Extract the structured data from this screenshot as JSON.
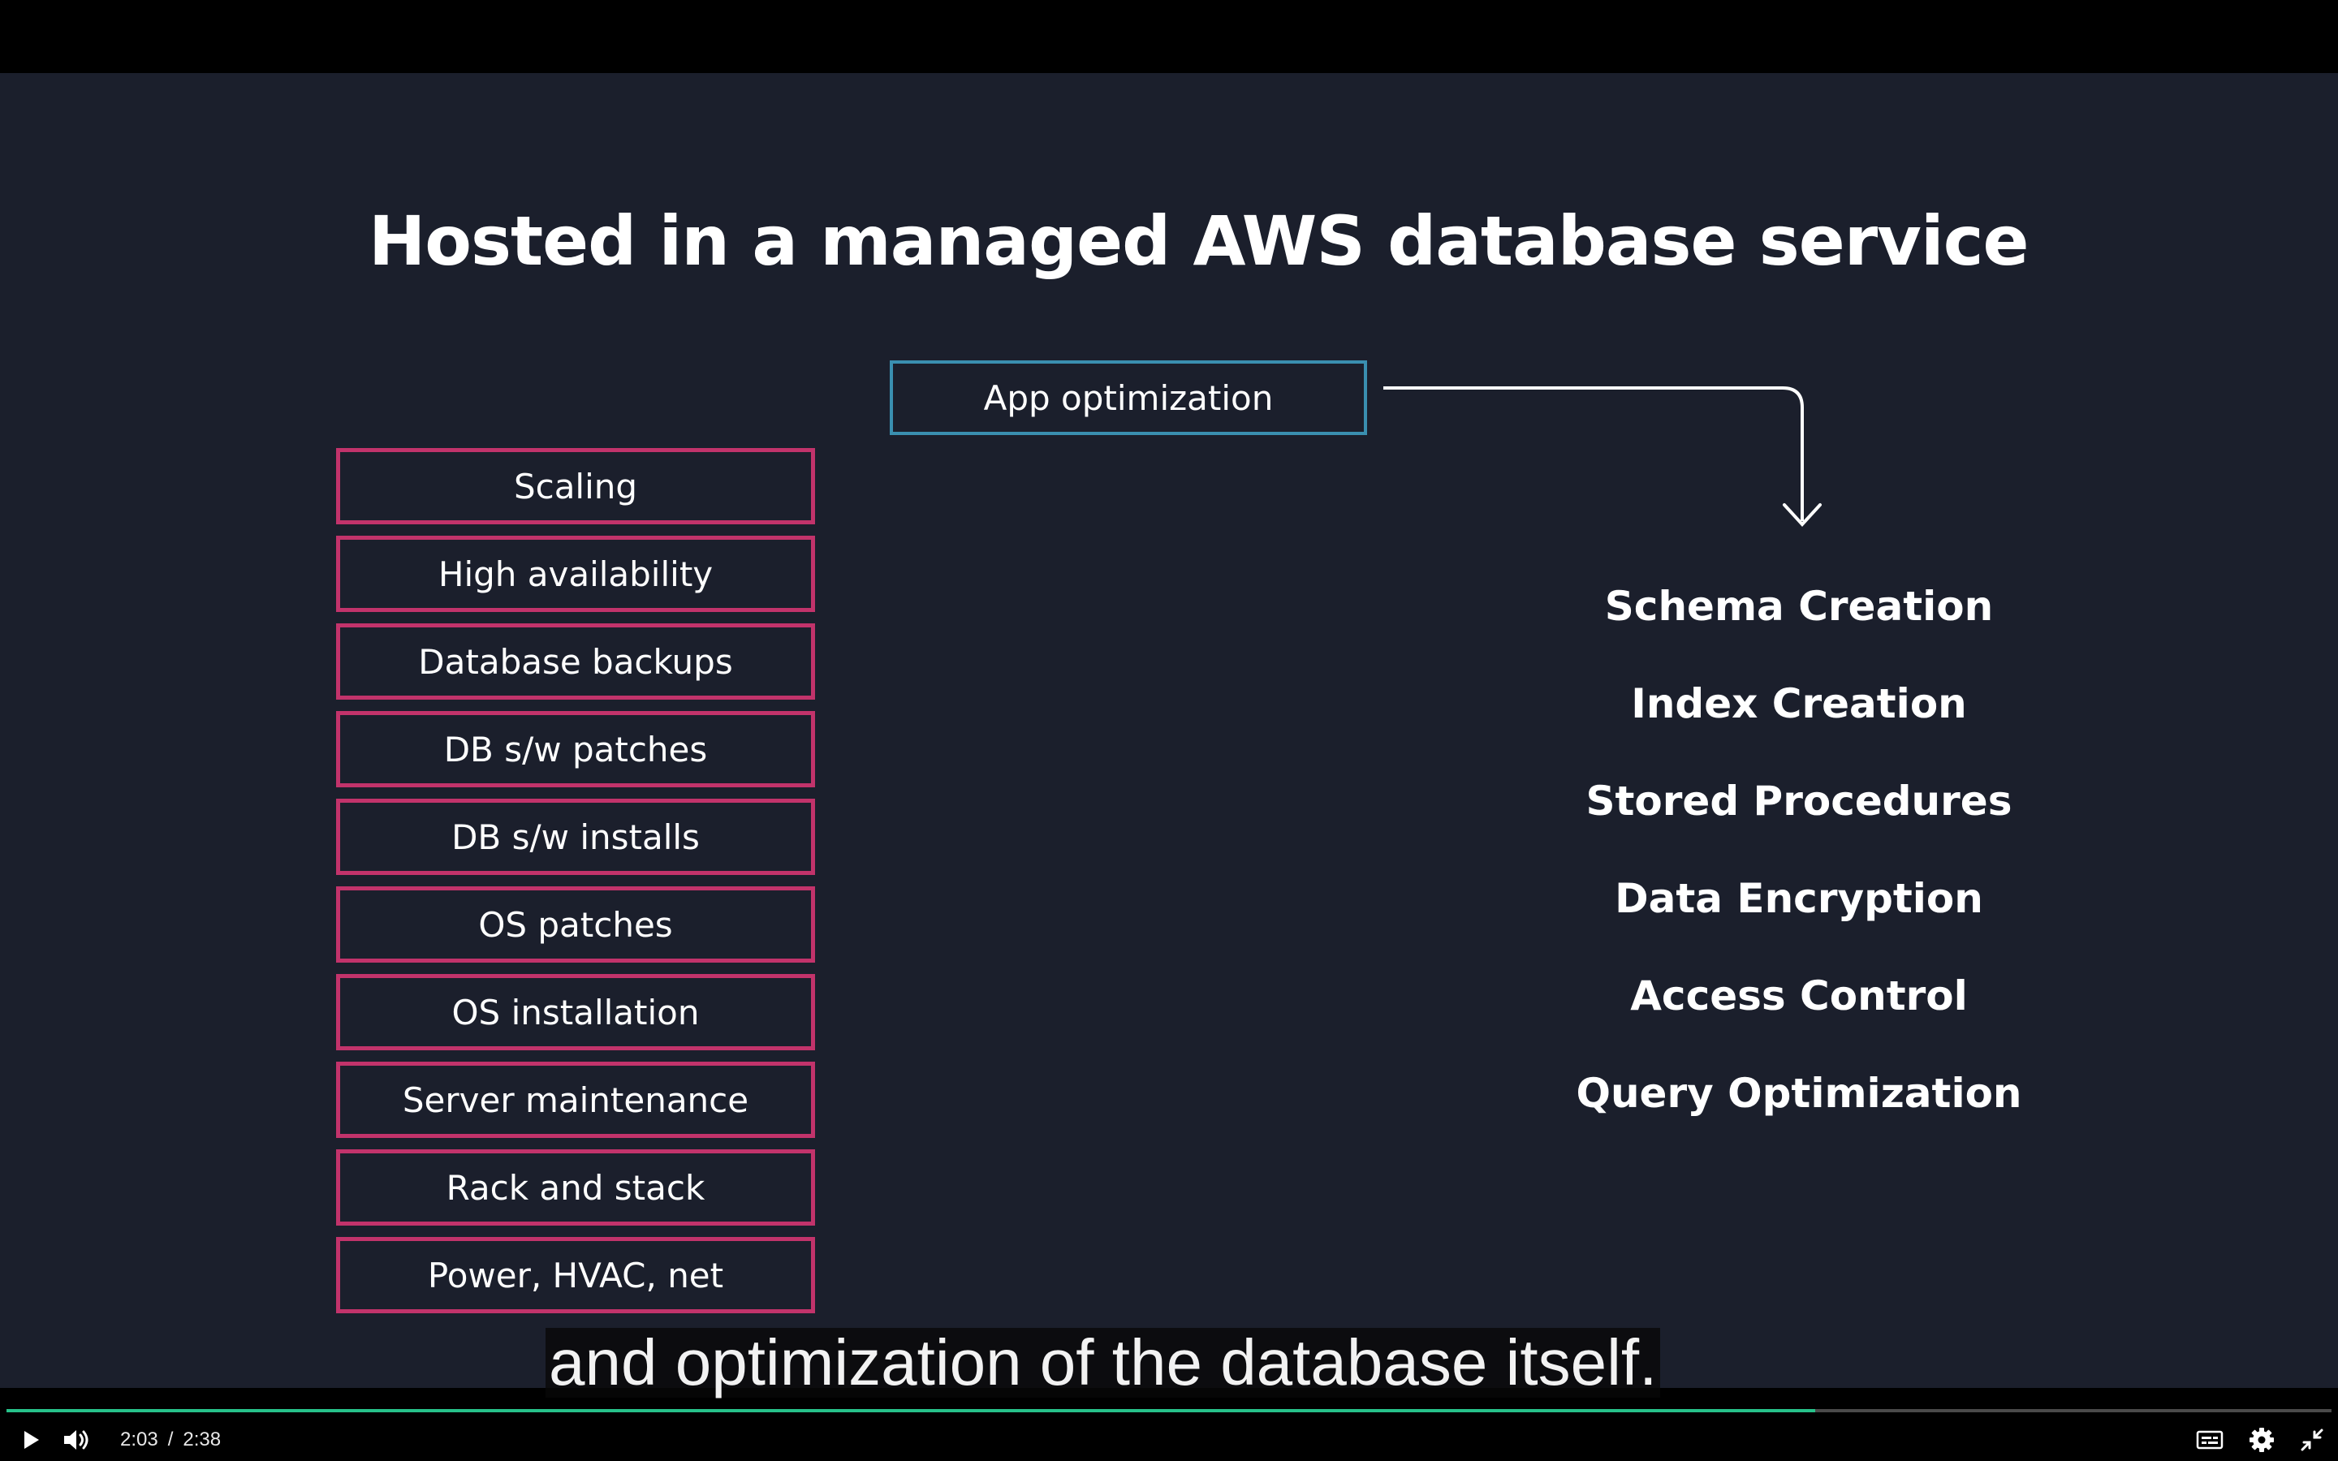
{
  "slide": {
    "title": "Hosted in a managed AWS database service",
    "app_box_label": "App optimization",
    "left_boxes": [
      "Scaling",
      "High availability",
      "Database backups",
      "DB s/w patches",
      "DB s/w installs",
      "OS patches",
      "OS installation",
      "Server maintenance",
      "Rack and stack",
      "Power, HVAC, net"
    ],
    "right_items": [
      "Schema Creation",
      "Index Creation",
      "Stored Procedures",
      "Data Encryption",
      "Access Control",
      "Query Optimization"
    ]
  },
  "caption": "and optimization of the database itself.",
  "player": {
    "current_time": "2:03",
    "time_separator": "/",
    "duration": "2:38",
    "progress_fraction": 0.778,
    "colors": {
      "progress": "#27c28a",
      "left_box_border": "#c2336b",
      "app_box_border": "#3a8fb0",
      "slide_background": "#1b1f2c"
    },
    "icons": [
      "play-icon",
      "volume-icon",
      "captions-icon",
      "settings-icon",
      "exit-fullscreen-icon"
    ]
  }
}
